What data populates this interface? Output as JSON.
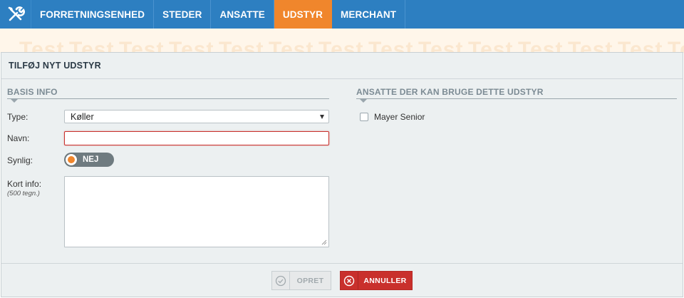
{
  "nav": {
    "logo_icon": "tools-icon",
    "items": [
      {
        "label": "FORRETNINGSENHED",
        "active": false
      },
      {
        "label": "STEDER",
        "active": false
      },
      {
        "label": "ANSATTE",
        "active": false
      },
      {
        "label": "UDSTYR",
        "active": true
      },
      {
        "label": "MERCHANT",
        "active": false
      }
    ]
  },
  "watermark": {
    "text": "Test"
  },
  "panel": {
    "title": "TILFØJ NYT UDSTYR"
  },
  "basis": {
    "heading": "BASIS INFO",
    "type_label": "Type:",
    "type_value": "Køller",
    "name_label": "Navn:",
    "name_value": "",
    "visible_label": "Synlig:",
    "visible_state": "NEJ",
    "info_label": "Kort info:",
    "info_hint": "(500 tegn.)",
    "info_value": ""
  },
  "employees": {
    "heading": "ANSATTE DER KAN BRUGE DETTE UDSTYR",
    "list": [
      {
        "name": "Mayer Senior",
        "checked": false
      }
    ]
  },
  "footer": {
    "create_label": "OPRET",
    "cancel_label": "ANNULLER"
  },
  "colors": {
    "nav_bg": "#2d7fc1",
    "nav_active": "#f0862c",
    "cancel": "#c9302c",
    "panel_bg": "#ecf0f1"
  }
}
